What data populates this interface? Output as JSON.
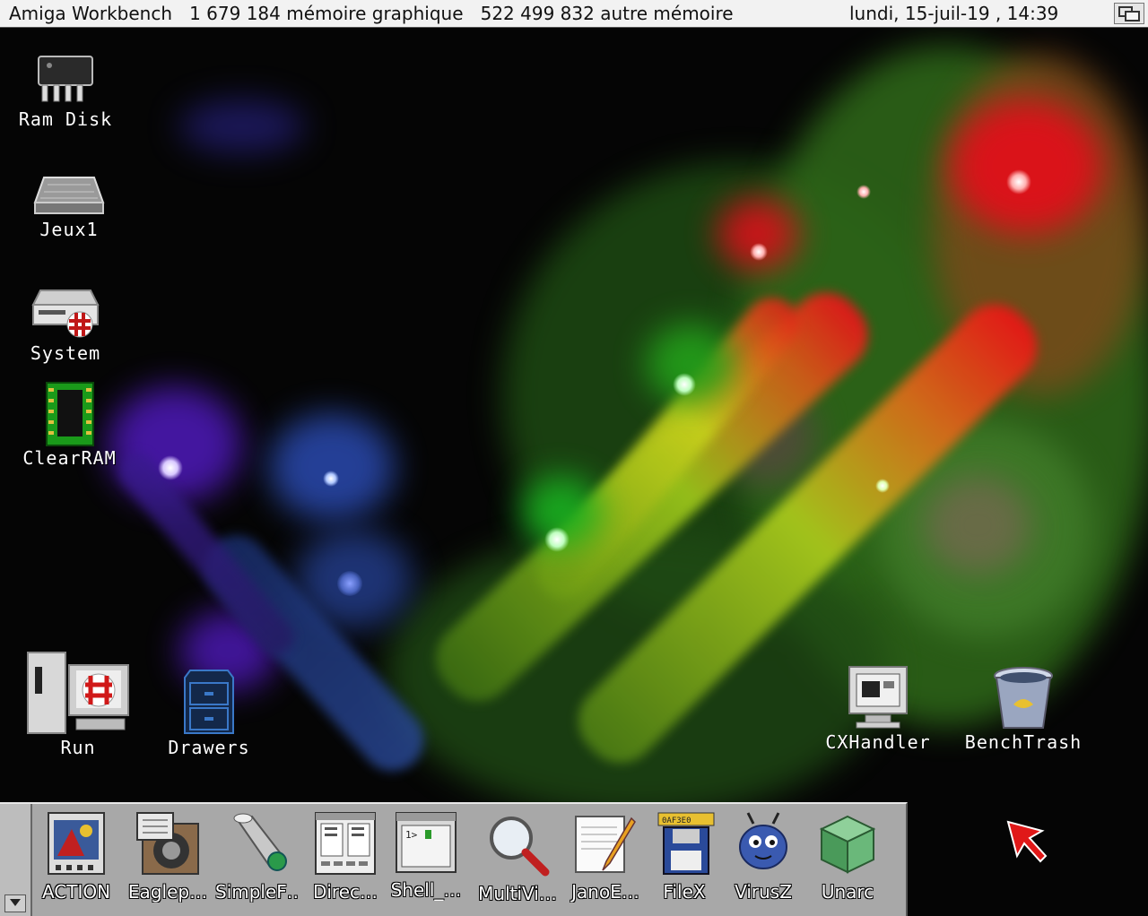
{
  "screen": {
    "title": "Amiga Workbench   1 679 184 mémoire graphique   522 499 832 autre mémoire",
    "clock": "lundi, 15-juil-19 , 14:39"
  },
  "desktop_icons": [
    {
      "label": "Ram Disk",
      "icon": "ram-chip-icon"
    },
    {
      "label": "Jeux1",
      "icon": "hard-drive-icon"
    },
    {
      "label": "System",
      "icon": "system-drive-icon"
    },
    {
      "label": "ClearRAM",
      "icon": "memory-chip-icon"
    },
    {
      "label": "Run",
      "icon": "computer-boing-icon"
    },
    {
      "label": "Drawers",
      "icon": "cabinet-icon"
    },
    {
      "label": "CXHandler",
      "icon": "monitor-icon"
    },
    {
      "label": "BenchTrash",
      "icon": "trash-can-icon"
    }
  ],
  "dock": {
    "items": [
      {
        "label": "ACTION"
      },
      {
        "label": "Eaglep…"
      },
      {
        "label": "SimpleF…"
      },
      {
        "label": "Direc…"
      },
      {
        "label": "Shell_…"
      },
      {
        "label": "MultiVi…"
      },
      {
        "label": "JanoE…"
      },
      {
        "label": "FileX"
      },
      {
        "label": "VirusZ"
      },
      {
        "label": "Unarc"
      }
    ]
  },
  "colors": {
    "titlebar_bg": "#f2f2f2",
    "dock_bg": "#a8a8a8",
    "desktop_bg": "#050505"
  }
}
